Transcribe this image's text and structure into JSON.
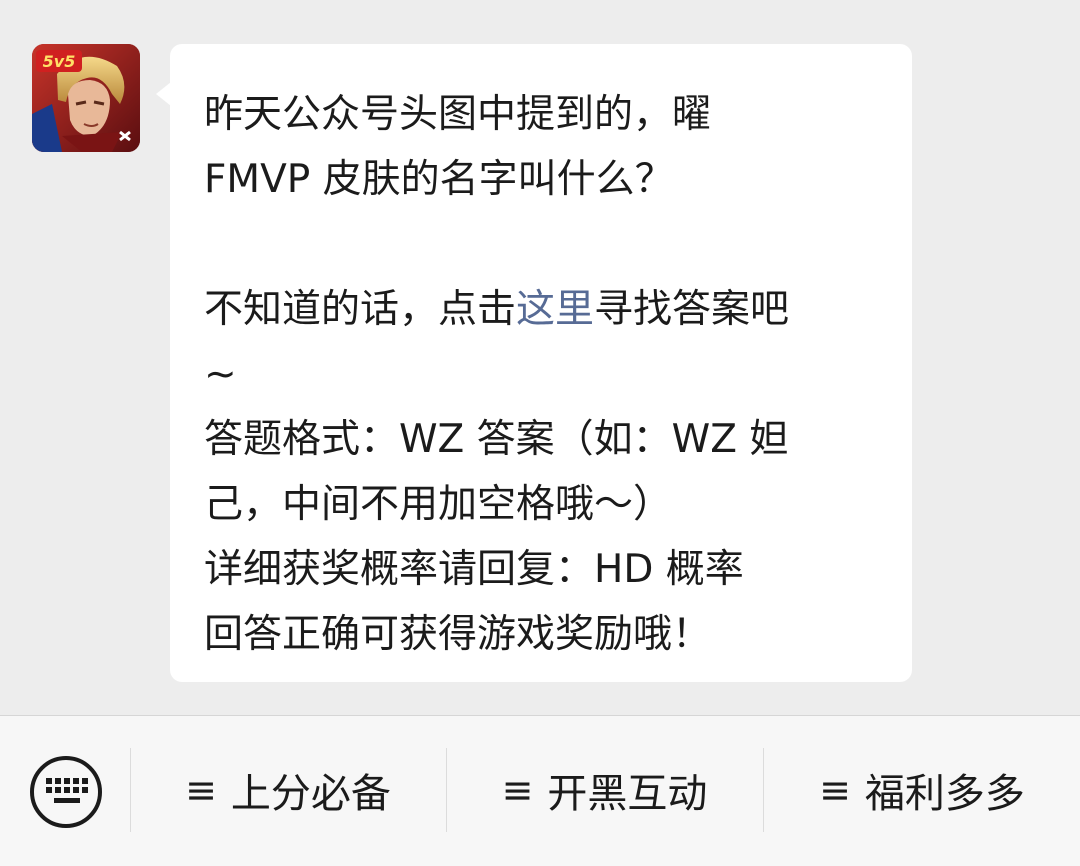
{
  "message": {
    "line1": "昨天公众号头图中提到的，曜",
    "line2": "FMVP 皮肤的名字叫什么？",
    "line3_pre": "不知道的话，点击",
    "line3_link": "这里",
    "line3_post": "寻找答案吧",
    "line4": "~",
    "line5": "答题格式：WZ 答案（如：WZ 妲",
    "line6": "己，中间不用加空格哦～）",
    "line7": "详细获奖概率请回复：HD 概率",
    "line8": "回答正确可获得游戏奖励哦！"
  },
  "avatar": {
    "badge": "5v5"
  },
  "menu": {
    "icon": "≡",
    "items": [
      {
        "label": "上分必备"
      },
      {
        "label": "开黑互动"
      },
      {
        "label": "福利多多"
      }
    ]
  },
  "colors": {
    "link": "#576b95",
    "background": "#ededed",
    "bubble": "#ffffff"
  }
}
